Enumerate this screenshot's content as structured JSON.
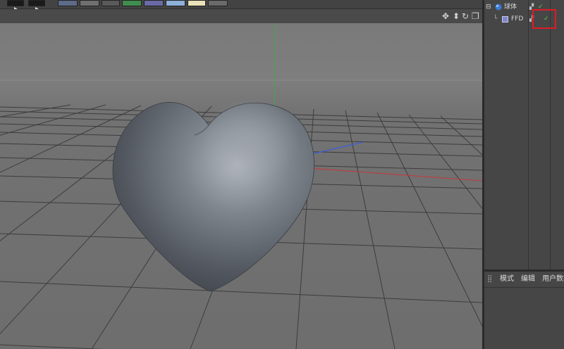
{
  "toolbar": {
    "buttons": [
      {
        "icon": "play-icon"
      },
      {
        "icon": "play-render-icon"
      },
      {
        "icon": "cube-icon"
      },
      {
        "icon": "target-icon"
      },
      {
        "icon": "pen-icon"
      },
      {
        "icon": "green-object-icon"
      },
      {
        "icon": "purple-object-icon"
      },
      {
        "icon": "floor-icon"
      },
      {
        "icon": "camera-icon"
      },
      {
        "icon": "light-icon"
      }
    ]
  },
  "viewport_nav": {
    "icons": [
      "move-view-icon",
      "scale-view-icon",
      "rotate-view-icon",
      "maximize-view-icon"
    ],
    "glyphs": [
      "✥",
      "⬍",
      "↻",
      "❐"
    ]
  },
  "object_manager": {
    "items": [
      {
        "name": "球体",
        "icon": "sphere-icon",
        "indent": 0
      },
      {
        "name": "FFD",
        "icon": "ffd-icon",
        "indent": 1
      }
    ]
  },
  "attributes": {
    "tabs": [
      "模式",
      "编辑",
      "用户数据"
    ]
  },
  "colors": {
    "x_axis": "#c8363a",
    "y_axis": "#3fae3f",
    "z_axis": "#3a5ee0",
    "highlight": "#e01b24",
    "check": "#4fd14f"
  }
}
